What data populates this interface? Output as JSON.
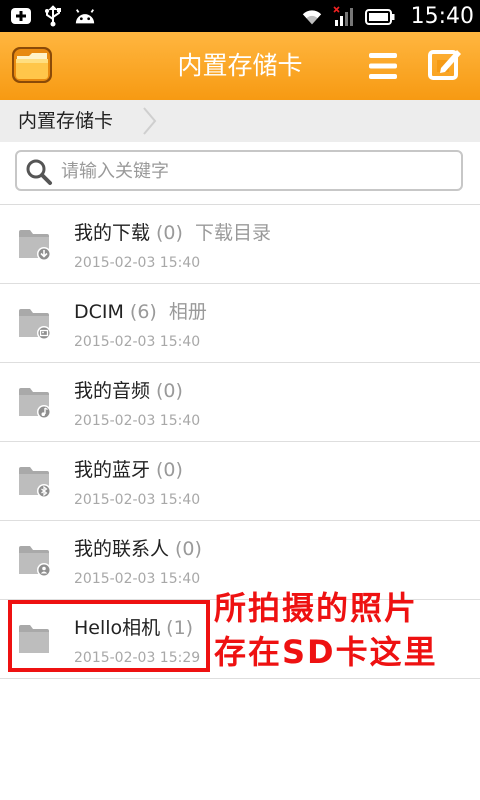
{
  "status_bar": {
    "time": "15:40"
  },
  "title_bar": {
    "title": "内置存储卡"
  },
  "breadcrumb": {
    "current": "内置存储卡"
  },
  "search": {
    "placeholder": "请输入关键字",
    "value": ""
  },
  "folders": [
    {
      "name": "我的下载",
      "count": "(0)",
      "desc": "下载目录",
      "date": "2015-02-03 15:40",
      "badge_icon": "download-icon"
    },
    {
      "name": "DCIM",
      "count": "(6)",
      "desc": "相册",
      "date": "2015-02-03 15:40",
      "badge_icon": "image-icon"
    },
    {
      "name": "我的音频",
      "count": "(0)",
      "desc": "",
      "date": "2015-02-03 15:40",
      "badge_icon": "music-note-icon"
    },
    {
      "name": "我的蓝牙",
      "count": "(0)",
      "desc": "",
      "date": "2015-02-03 15:40",
      "badge_icon": "bluetooth-icon"
    },
    {
      "name": "我的联系人",
      "count": "(0)",
      "desc": "",
      "date": "2015-02-03 15:40",
      "badge_icon": "contact-icon"
    },
    {
      "name": "Hello相机",
      "count": "(1)",
      "desc": "",
      "date": "2015-02-03 15:29",
      "badge_icon": ""
    }
  ],
  "annotation": {
    "line1": "所拍摄的照片",
    "line2": "存在SD卡这里",
    "color": "#ee1111"
  },
  "colors": {
    "title_bar": "#f9a21a",
    "status_bar": "#000000"
  }
}
